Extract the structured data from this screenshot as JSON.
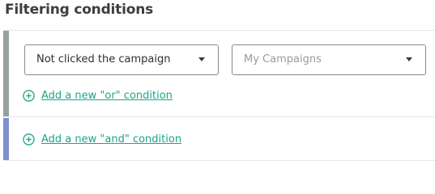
{
  "section": {
    "title": "Filtering conditions"
  },
  "or_group": {
    "condition_select": {
      "value": "Not clicked the campaign"
    },
    "campaign_select": {
      "placeholder": "My Campaigns"
    },
    "add_or_label": "Add a new \"or\" condition"
  },
  "and_group": {
    "add_and_label": "Add a new \"and\" condition"
  },
  "icons": {
    "add": "plus-circle-icon",
    "dropdown": "caret-down-icon"
  },
  "colors": {
    "accent_green": "#1aa58a",
    "or_bar": "#95a3a0",
    "and_bar": "#7f8fcf"
  }
}
